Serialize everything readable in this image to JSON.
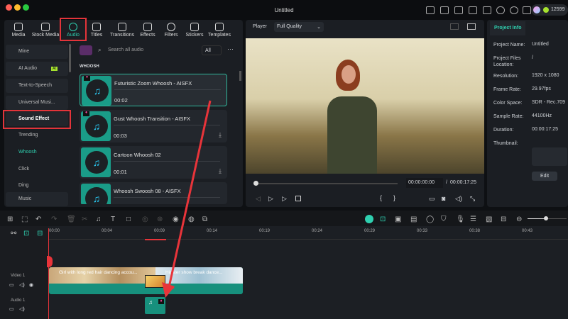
{
  "window": {
    "title": "Untitled",
    "credits": "12599"
  },
  "tabs": [
    {
      "label": "Media"
    },
    {
      "label": "Stock Media"
    },
    {
      "label": "Audio"
    },
    {
      "label": "Titles"
    },
    {
      "label": "Transitions"
    },
    {
      "label": "Effects"
    },
    {
      "label": "Filters"
    },
    {
      "label": "Stickers"
    },
    {
      "label": "Templates"
    }
  ],
  "sidebar": {
    "mine": "Mine",
    "ai_audio": "AI Audio",
    "ai_badge": "AI",
    "tts": "Text-to-Speech",
    "universal": "Universal Musi...",
    "sound_effect": "Sound Effect",
    "subs": [
      "Trending",
      "Whoosh",
      "Click",
      "Ding"
    ],
    "music": "Music"
  },
  "library": {
    "search_placeholder": "Search all audio",
    "filter": "All",
    "section": "WHOOSH",
    "items": [
      {
        "name": "Futuristic Zoom Whoosh - AISFX",
        "duration": "00:02"
      },
      {
        "name": "Gust Whoosh Transition - AISFX",
        "duration": "00:03"
      },
      {
        "name": "Cartoon Whoosh 02",
        "duration": "00:01"
      },
      {
        "name": "Whoosh Swoosh 08 - AISFX",
        "duration": ""
      }
    ]
  },
  "player": {
    "label": "Player",
    "quality": "Full Quality",
    "current": "00:00:00:00",
    "separator": "/",
    "total": "00:00:17:25"
  },
  "project_info": {
    "tab": "Project Info",
    "fields": [
      {
        "label": "Project Name:",
        "value": "Untitled"
      },
      {
        "label": "Project Files Location:",
        "value": "/"
      },
      {
        "label": "Resolution:",
        "value": "1920 x 1080"
      },
      {
        "label": "Frame Rate:",
        "value": "29.97fps"
      },
      {
        "label": "Color Space:",
        "value": "SDR - Rec.709"
      },
      {
        "label": "Sample Rate:",
        "value": "44100Hz"
      },
      {
        "label": "Duration:",
        "value": "00:00:17:25"
      }
    ],
    "thumbnail_label": "Thumbnail:",
    "edit": "Edit"
  },
  "timeline": {
    "ruler": [
      "00:00",
      "00:04",
      "00:09",
      "00:14",
      "00:19",
      "00:24",
      "00:29",
      "00:33",
      "00:38",
      "00:43"
    ],
    "video_track": "Video 1",
    "audio_track": "Audio 1",
    "clips": [
      "Girl with long red hair dancing accou...",
      "Hipster show break dance..."
    ]
  }
}
